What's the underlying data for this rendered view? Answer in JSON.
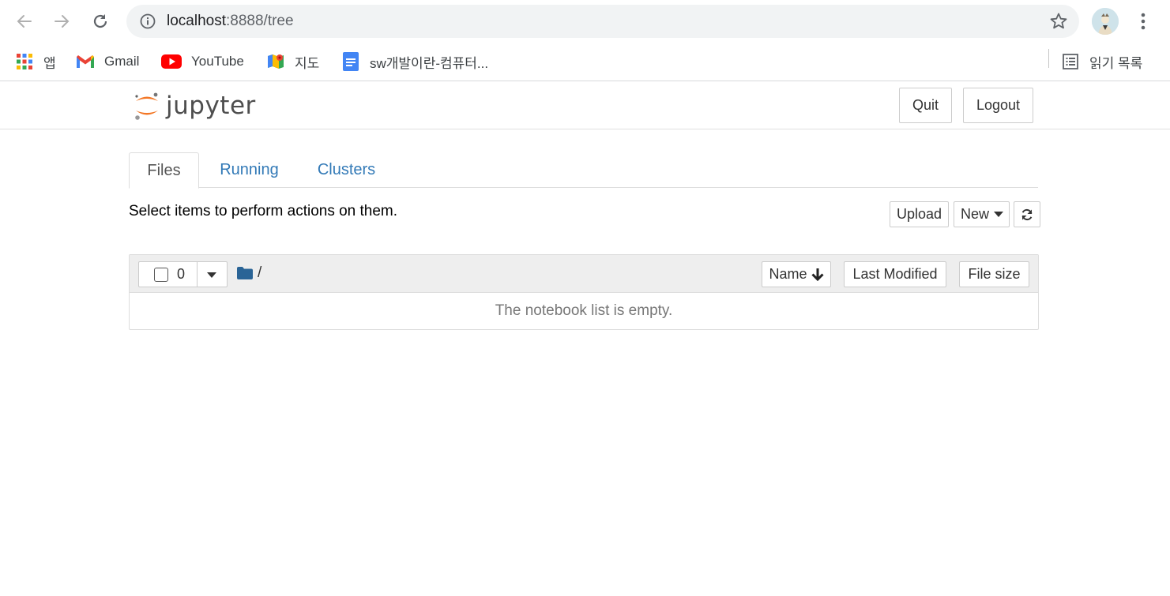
{
  "browser": {
    "url_host": "localhost",
    "url_rest": ":8888/tree",
    "bookmarks": [
      {
        "label": "앱",
        "icon": "apps-grid-icon"
      },
      {
        "label": "Gmail",
        "icon": "gmail-icon"
      },
      {
        "label": "YouTube",
        "icon": "youtube-icon"
      },
      {
        "label": "지도",
        "icon": "maps-icon"
      },
      {
        "label": "sw개발이란-컴퓨터...",
        "icon": "docs-icon"
      }
    ],
    "reading_list": "읽기 목록"
  },
  "header": {
    "logo_text": "jupyter",
    "quit_label": "Quit",
    "logout_label": "Logout"
  },
  "tabs": [
    {
      "label": "Files",
      "active": true
    },
    {
      "label": "Running",
      "active": false
    },
    {
      "label": "Clusters",
      "active": false
    }
  ],
  "toolbar": {
    "hint": "Select items to perform actions on them.",
    "upload_label": "Upload",
    "new_label": "New"
  },
  "file_list": {
    "selected_count": "0",
    "breadcrumb": "/",
    "sort_name": "Name",
    "sort_modified": "Last Modified",
    "sort_size": "File size",
    "empty_message": "The notebook list is empty."
  },
  "colors": {
    "link": "#337ab7",
    "jupyter_orange": "#f37726",
    "folder": "#2a6496"
  }
}
